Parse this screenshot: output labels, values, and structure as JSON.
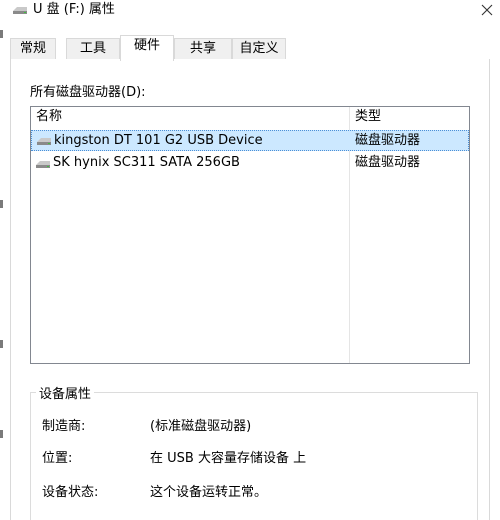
{
  "window": {
    "title": "U 盘 (F:) 属性",
    "icon": "drive-icon",
    "close_icon": "close-icon"
  },
  "tabs": [
    {
      "label": "常规",
      "active": false
    },
    {
      "label": "工具",
      "active": false
    },
    {
      "label": "硬件",
      "active": true
    },
    {
      "label": "共享",
      "active": false
    },
    {
      "label": "自定义",
      "active": false
    }
  ],
  "hardware": {
    "list_label": "所有磁盘驱动器(D):",
    "columns": [
      "名称",
      "类型"
    ],
    "rows": [
      {
        "name": "kingston DT 101 G2 USB Device",
        "type": "磁盘驱动器",
        "selected": true
      },
      {
        "name": "SK hynix SC311 SATA 256GB",
        "type": "磁盘驱动器",
        "selected": false
      }
    ]
  },
  "properties": {
    "group_title": "设备属性",
    "manufacturer_label": "制造商:",
    "manufacturer_value": "(标准磁盘驱动器)",
    "location_label": "位置:",
    "location_value": "在 USB 大容量存储设备 上",
    "status_label": "设备状态:",
    "status_value": "这个设备运转正常。"
  },
  "colors": {
    "selection_bg": "#cce8ff",
    "selection_border": "#4c8fd6",
    "tab_border": "#d9d9d9"
  }
}
